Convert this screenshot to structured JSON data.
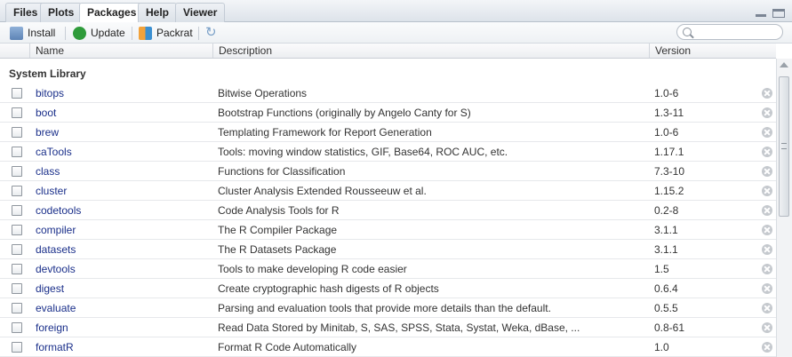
{
  "tabs": [
    {
      "label": "Files",
      "active": false
    },
    {
      "label": "Plots",
      "active": false
    },
    {
      "label": "Packages",
      "active": true
    },
    {
      "label": "Help",
      "active": false
    },
    {
      "label": "Viewer",
      "active": false
    }
  ],
  "toolbar": {
    "install_label": "Install",
    "update_label": "Update",
    "packrat_label": "Packrat",
    "refresh_icon": "refresh-icon"
  },
  "search": {
    "placeholder": "",
    "value": ""
  },
  "columns": {
    "name": "Name",
    "description": "Description",
    "version": "Version"
  },
  "section_title": "System Library",
  "packages": [
    {
      "name": "bitops",
      "description": "Bitwise Operations",
      "version": "1.0-6"
    },
    {
      "name": "boot",
      "description": "Bootstrap Functions (originally by Angelo Canty for S)",
      "version": "1.3-11"
    },
    {
      "name": "brew",
      "description": "Templating Framework for Report Generation",
      "version": "1.0-6"
    },
    {
      "name": "caTools",
      "description": "Tools: moving window statistics, GIF, Base64, ROC AUC, etc.",
      "version": "1.17.1"
    },
    {
      "name": "class",
      "description": "Functions for Classification",
      "version": "7.3-10"
    },
    {
      "name": "cluster",
      "description": "Cluster Analysis Extended Rousseeuw et al.",
      "version": "1.15.2"
    },
    {
      "name": "codetools",
      "description": "Code Analysis Tools for R",
      "version": "0.2-8"
    },
    {
      "name": "compiler",
      "description": "The R Compiler Package",
      "version": "3.1.1"
    },
    {
      "name": "datasets",
      "description": "The R Datasets Package",
      "version": "3.1.1"
    },
    {
      "name": "devtools",
      "description": "Tools to make developing R code easier",
      "version": "1.5"
    },
    {
      "name": "digest",
      "description": "Create cryptographic hash digests of R objects",
      "version": "0.6.4"
    },
    {
      "name": "evaluate",
      "description": "Parsing and evaluation tools that provide more details than the default.",
      "version": "0.5.5"
    },
    {
      "name": "foreign",
      "description": "Read Data Stored by Minitab, S, SAS, SPSS, Stata, Systat, Weka, dBase, ...",
      "version": "0.8-61"
    },
    {
      "name": "formatR",
      "description": "Format R Code Automatically",
      "version": "1.0"
    }
  ]
}
